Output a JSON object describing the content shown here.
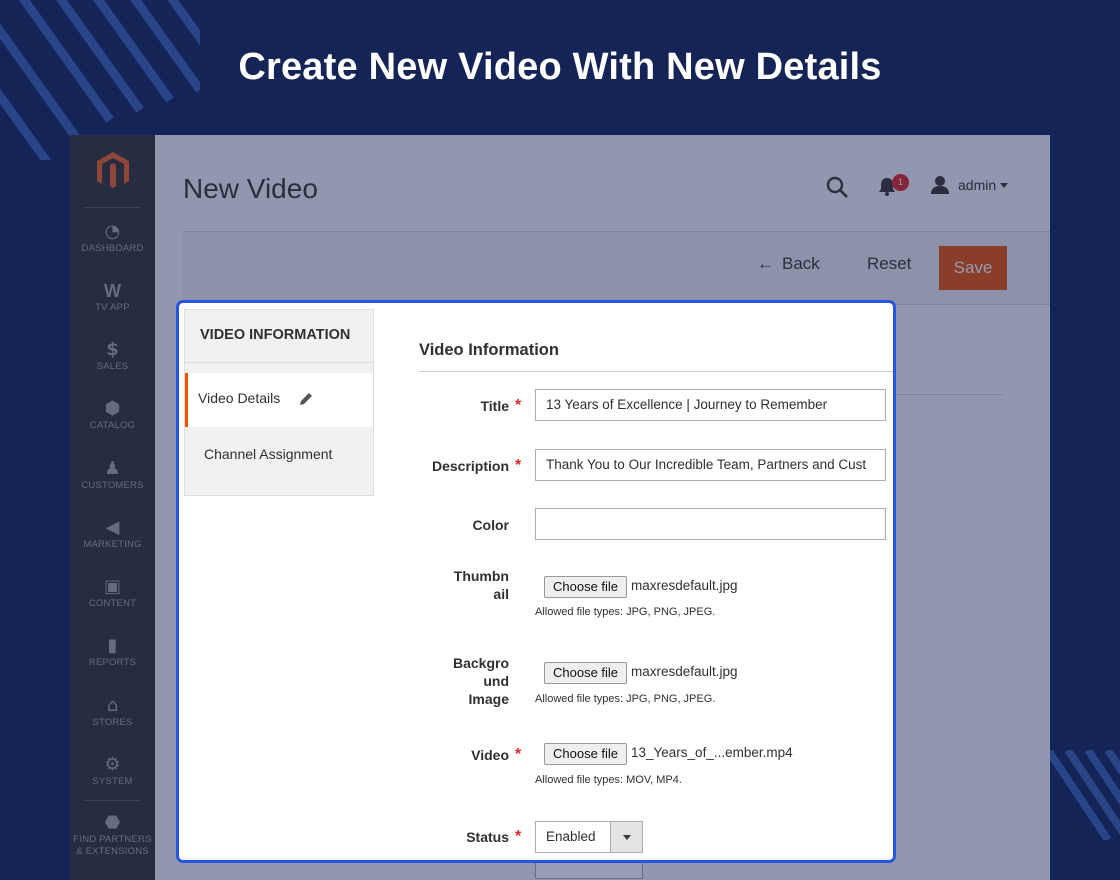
{
  "banner": {
    "title": "Create New Video With New Details"
  },
  "header": {
    "page_title": "New Video",
    "notification_count": "1",
    "user": "admin"
  },
  "actions": {
    "back": "Back",
    "reset": "Reset",
    "save": "Save"
  },
  "sidebar_menu": [
    {
      "label": "DASHBOARD",
      "icon": "dashboard-icon"
    },
    {
      "label": "TV APP",
      "icon": "tv-app-icon"
    },
    {
      "label": "SALES",
      "icon": "dollar-icon"
    },
    {
      "label": "CATALOG",
      "icon": "box-icon"
    },
    {
      "label": "CUSTOMERS",
      "icon": "person-icon"
    },
    {
      "label": "MARKETING",
      "icon": "megaphone-icon"
    },
    {
      "label": "CONTENT",
      "icon": "layout-icon"
    },
    {
      "label": "REPORTS",
      "icon": "bar-chart-icon"
    },
    {
      "label": "STORES",
      "icon": "store-icon"
    },
    {
      "label": "SYSTEM",
      "icon": "gear-icon"
    },
    {
      "label": "FIND PARTNERS",
      "label2": "& EXTENSIONS",
      "icon": "cube-icon"
    }
  ],
  "tabs": {
    "heading": "VIDEO INFORMATION",
    "items": [
      "Video Details",
      "Channel Assignment"
    ]
  },
  "form": {
    "section_title": "Video Information",
    "title": {
      "label": "Title",
      "value": "13 Years of Excellence | Journey to Remember"
    },
    "description": {
      "label": "Description",
      "value": "Thank You to Our Incredible Team, Partners and Cust"
    },
    "color": {
      "label": "Color",
      "value": ""
    },
    "thumbnail": {
      "label_1": "Thumbn",
      "label_2": "ail",
      "button": "Choose file",
      "file": "maxresdefault.jpg",
      "hint": "Allowed file types: JPG, PNG, JPEG."
    },
    "background": {
      "label_1": "Backgro",
      "label_2": "und",
      "label_3": "Image",
      "button": "Choose file",
      "file": "maxresdefault.jpg",
      "hint": "Allowed file types: JPG, PNG, JPEG."
    },
    "video": {
      "label": "Video",
      "button": "Choose file",
      "file": "13_Years_of_...ember.mp4",
      "hint": "Allowed file types: MOV, MP4."
    },
    "status": {
      "label": "Status",
      "value": "Enabled"
    },
    "required_mark": "*"
  },
  "colors": {
    "background": "#142456",
    "accent": "#eb5202",
    "highlight_border": "#2255e0",
    "menu": "#373330"
  }
}
